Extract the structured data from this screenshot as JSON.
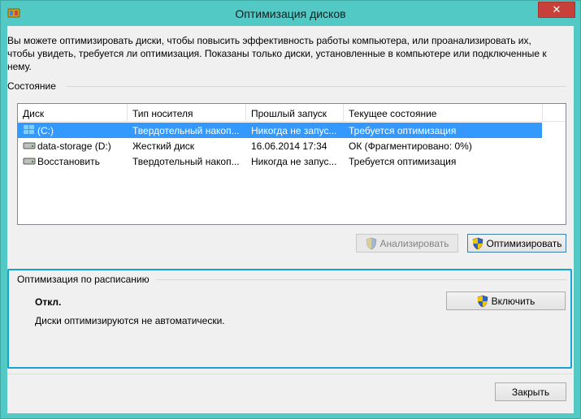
{
  "window": {
    "title": "Оптимизация дисков",
    "close_glyph": "✕"
  },
  "intro_text": "Вы можете оптимизировать диски, чтобы повысить эффективность работы  компьютера, или проанализировать их, чтобы увидеть, требуется ли оптимизация. Показаны только диски, установленные в компьютере или подключенные к нему.",
  "status_section": {
    "label": "Состояние",
    "columns": [
      "Диск",
      "Тип носителя",
      "Прошлый запуск",
      "Текущее состояние"
    ],
    "rows": [
      {
        "icon": "windows-drive-icon",
        "disk": "(C:)",
        "media": "Твердотельный накоп...",
        "last_run": "Никогда не запус...",
        "status": "Требуется оптимизация",
        "selected": true
      },
      {
        "icon": "hard-drive-icon",
        "disk": "data-storage (D:)",
        "media": "Жесткий диск",
        "last_run": "16.06.2014 17:34",
        "status": "ОК (Фрагментировано: 0%)",
        "selected": false
      },
      {
        "icon": "hard-drive-icon",
        "disk": "Восстановить",
        "media": "Твердотельный накоп...",
        "last_run": "Никогда не запус...",
        "status": "Требуется оптимизация",
        "selected": false
      }
    ]
  },
  "buttons": {
    "analyze": "Анализировать",
    "optimize": "Оптимизировать",
    "enable": "Включить",
    "close": "Закрыть"
  },
  "schedule": {
    "label": "Оптимизация по расписанию",
    "status": "Откл.",
    "description": "Диски оптимизируются не автоматически."
  },
  "colors": {
    "frame": "#52c9c5",
    "selection": "#3399ff",
    "highlight_box": "#16a2d8"
  }
}
